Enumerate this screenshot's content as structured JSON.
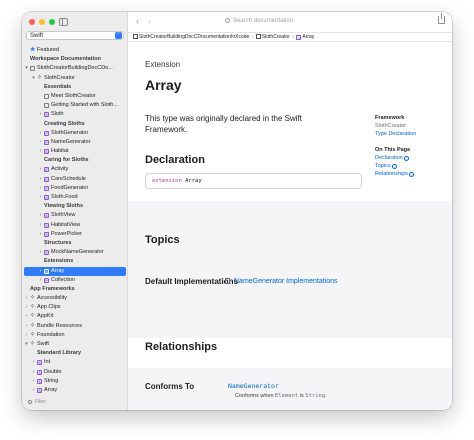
{
  "sidebar": {
    "language": "Swift",
    "filter_placeholder": "Filter",
    "items": [
      {
        "label": "Featured",
        "indent": 0,
        "icon": "star",
        "disclosure": "",
        "kind": "item"
      },
      {
        "label": "Workspace Documentation",
        "indent": 0,
        "icon": "",
        "disclosure": "",
        "kind": "section"
      },
      {
        "label": "SlothCreatorBuildingDocCDo...",
        "indent": 0,
        "icon": "doc",
        "disclosure": "▾",
        "kind": "item"
      },
      {
        "label": "SlothCreator",
        "indent": 1,
        "icon": "grid",
        "disclosure": "▾",
        "kind": "item"
      },
      {
        "label": "Essentials",
        "indent": 2,
        "icon": "",
        "disclosure": "",
        "kind": "section"
      },
      {
        "label": "Meet SlothCreator",
        "indent": 2,
        "icon": "doc",
        "disclosure": "",
        "kind": "item"
      },
      {
        "label": "Getting Started with Sloth...",
        "indent": 2,
        "icon": "doc",
        "disclosure": "",
        "kind": "item"
      },
      {
        "label": "Sloth",
        "indent": 2,
        "icon": "S",
        "disclosure": "›",
        "kind": "item"
      },
      {
        "label": "Creating Sloths",
        "indent": 2,
        "icon": "",
        "disclosure": "",
        "kind": "section"
      },
      {
        "label": "SlothGenerator",
        "indent": 2,
        "icon": "P",
        "disclosure": "›",
        "kind": "item"
      },
      {
        "label": "NameGenerator",
        "indent": 2,
        "icon": "P",
        "disclosure": "›",
        "kind": "item"
      },
      {
        "label": "Habitat",
        "indent": 2,
        "icon": "S",
        "disclosure": "›",
        "kind": "item"
      },
      {
        "label": "Caring for Sloths",
        "indent": 2,
        "icon": "",
        "disclosure": "",
        "kind": "section"
      },
      {
        "label": "Activity",
        "indent": 2,
        "icon": "E",
        "disclosure": "›",
        "kind": "item"
      },
      {
        "label": "CareSchedule",
        "indent": 2,
        "icon": "S",
        "disclosure": "›",
        "kind": "item"
      },
      {
        "label": "FoodGenerator",
        "indent": 2,
        "icon": "P",
        "disclosure": "›",
        "kind": "item"
      },
      {
        "label": "Sloth.Food",
        "indent": 2,
        "icon": "S",
        "disclosure": "›",
        "kind": "item"
      },
      {
        "label": "Viewing Sloths",
        "indent": 2,
        "icon": "",
        "disclosure": "",
        "kind": "section"
      },
      {
        "label": "SlothView",
        "indent": 2,
        "icon": "S",
        "disclosure": "›",
        "kind": "item"
      },
      {
        "label": "HabitatView",
        "indent": 2,
        "icon": "S",
        "disclosure": "›",
        "kind": "item"
      },
      {
        "label": "PowerPicker",
        "indent": 2,
        "icon": "S",
        "disclosure": "›",
        "kind": "item"
      },
      {
        "label": "Structures",
        "indent": 2,
        "icon": "",
        "disclosure": "",
        "kind": "section"
      },
      {
        "label": "MockNameGenerator",
        "indent": 2,
        "icon": "S",
        "disclosure": "›",
        "kind": "item"
      },
      {
        "label": "Extensions",
        "indent": 2,
        "icon": "",
        "disclosure": "",
        "kind": "section"
      },
      {
        "label": "Array",
        "indent": 2,
        "icon": "S",
        "disclosure": "›",
        "kind": "selected"
      },
      {
        "label": "Collection",
        "indent": 2,
        "icon": "P",
        "disclosure": "›",
        "kind": "item"
      },
      {
        "label": "App Frameworks",
        "indent": 0,
        "icon": "",
        "disclosure": "",
        "kind": "section"
      },
      {
        "label": "Accessibility",
        "indent": 0,
        "icon": "grid",
        "disclosure": "›",
        "kind": "item"
      },
      {
        "label": "App Clips",
        "indent": 0,
        "icon": "grid",
        "disclosure": "›",
        "kind": "item"
      },
      {
        "label": "AppKit",
        "indent": 0,
        "icon": "grid",
        "disclosure": "›",
        "kind": "item"
      },
      {
        "label": "Bundle Resources",
        "indent": 0,
        "icon": "grid",
        "disclosure": "›",
        "kind": "item"
      },
      {
        "label": "Foundation",
        "indent": 0,
        "icon": "grid",
        "disclosure": "›",
        "kind": "item"
      },
      {
        "label": "Swift",
        "indent": 0,
        "icon": "grid",
        "disclosure": "▾",
        "kind": "item"
      },
      {
        "label": "Standard Library",
        "indent": 1,
        "icon": "",
        "disclosure": "",
        "kind": "section"
      },
      {
        "label": "Int",
        "indent": 1,
        "icon": "S",
        "disclosure": "›",
        "kind": "item"
      },
      {
        "label": "Double",
        "indent": 1,
        "icon": "S",
        "disclosure": "›",
        "kind": "item"
      },
      {
        "label": "String",
        "indent": 1,
        "icon": "S",
        "disclosure": "›",
        "kind": "item"
      },
      {
        "label": "Array",
        "indent": 1,
        "icon": "S",
        "disclosure": "›",
        "kind": "item"
      }
    ]
  },
  "toolbar": {
    "back": "‹",
    "forward": "›",
    "search_placeholder": "Search documentation"
  },
  "breadcrumb": {
    "doc": "SlothCreatorBuildingDocCDocumentationInXcode",
    "module": "SlothCreator",
    "symbol": "Array",
    "separator": "›"
  },
  "main": {
    "eyebrow": "Extension",
    "title": "Array",
    "abstract": "This type  was originally declared in the Swift Framework.",
    "declaration_heading": "Declaration",
    "declaration_keyword": "extension",
    "declaration_type": "Array",
    "topics_heading": "Topics",
    "default_impl_label": "Default Implementations",
    "default_impl_link": "NameGenerator Implementations",
    "relationships_heading": "Relationships",
    "conforms_label": "Conforms To",
    "conforms_link": "NameGenerator",
    "conforms_note_prefix": "Conforms when ",
    "conforms_note_code": "Element",
    "conforms_note_mid": " is ",
    "conforms_note_code2": "String",
    "conforms_note_suffix": "."
  },
  "meta": {
    "framework_heading": "Framework",
    "framework_value": "SlothCreator",
    "framework_link": "Type Declaration",
    "on_page_heading": "On This Page",
    "on_page_links": [
      "Declaration",
      "Topics",
      "Relationships"
    ]
  },
  "colors": {
    "accent": "#2f7cf6",
    "link": "#0066cc",
    "keyword": "#ad3da4"
  }
}
